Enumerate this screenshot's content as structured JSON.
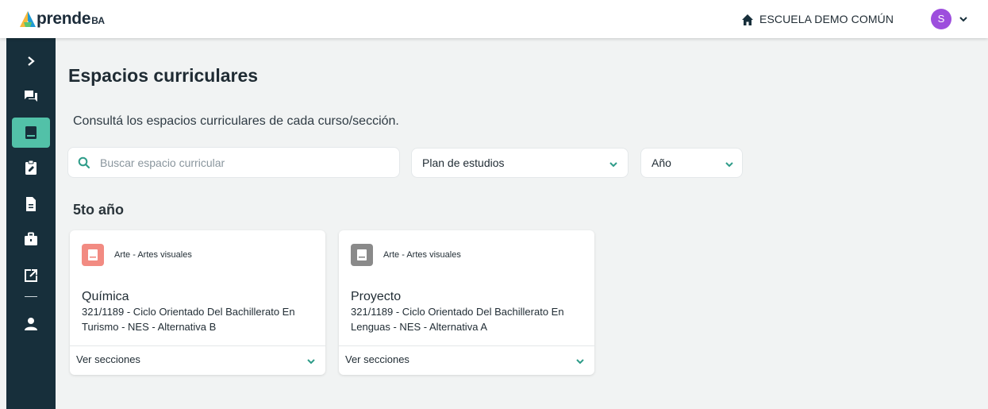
{
  "header": {
    "logo_text": "prende",
    "logo_suffix": "BA",
    "school_name": "ESCUELA DEMO COMÚN",
    "avatar_initial": "S",
    "icons": {
      "home": "home-icon",
      "user_menu": "chevron-down-icon"
    }
  },
  "sidebar": {
    "items": [
      {
        "icon": "chevron-right-icon",
        "active": false
      },
      {
        "icon": "chat-icon",
        "active": false
      },
      {
        "icon": "book-icon",
        "active": true
      },
      {
        "icon": "clipboard-edit-icon",
        "active": false
      },
      {
        "icon": "document-icon",
        "active": false
      },
      {
        "icon": "briefcase-icon",
        "active": false
      },
      {
        "icon": "external-link-icon",
        "active": false
      },
      {
        "icon": "user-icon",
        "active": false
      }
    ],
    "colors": {
      "background": "#172f3b",
      "active": "#52c1a8"
    }
  },
  "main": {
    "title": "Espacios curriculares",
    "subtitle": "Consultá los espacios curriculares de cada curso/sección.",
    "search": {
      "placeholder": "Buscar espacio curricular",
      "value": ""
    },
    "filters": {
      "plan": {
        "label": "Plan de estudios"
      },
      "year": {
        "label": "Año"
      }
    },
    "section_title": "5to año",
    "cards": [
      {
        "area": "Arte - Artes visuales",
        "name": "Química",
        "description": "321/1189 - Ciclo Orientado Del Bachillerato En Turismo - NES - Alternativa B",
        "footer": "Ver secciones",
        "icon_color": "#f28b82"
      },
      {
        "area": "Arte - Artes visuales",
        "name": "Proyecto",
        "description": "321/1189 - Ciclo Orientado Del Bachillerato En Lenguas - NES - Alternativa A",
        "footer": "Ver secciones",
        "icon_color": "#8a8a8a"
      }
    ]
  },
  "colors": {
    "accent": "#2e9c89",
    "avatar": "#9d4edd",
    "page_bg": "#f1f3f3"
  }
}
